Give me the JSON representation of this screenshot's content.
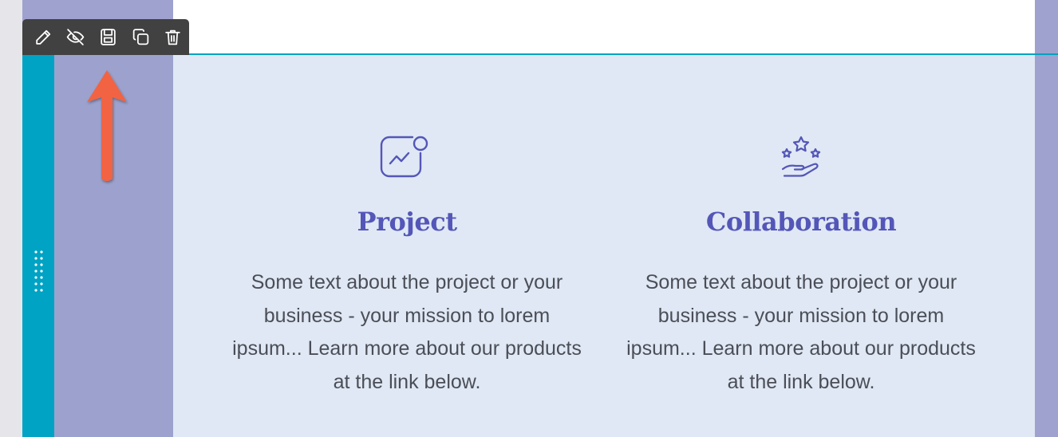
{
  "toolbar": {
    "buttons": [
      {
        "name": "edit",
        "icon": "pencil-icon"
      },
      {
        "name": "hide",
        "icon": "eye-off-icon"
      },
      {
        "name": "save",
        "icon": "floppy-disk-icon"
      },
      {
        "name": "duplicate",
        "icon": "copy-icon"
      },
      {
        "name": "delete",
        "icon": "trash-icon"
      }
    ]
  },
  "annotation": {
    "arrow_color": "#f16442",
    "points_to": "hide-button"
  },
  "cards": [
    {
      "icon": "image-chart-icon",
      "title": "Project",
      "text": "Some text about the project or your business - your mission to lorem ipsum... Learn more about our products at the link below."
    },
    {
      "icon": "hand-stars-icon",
      "title": "Collaboration",
      "text": "Some text about the project or your business - your mission to lorem ipsum... Learn more about our products at the link below."
    }
  ],
  "colors": {
    "selection": "#00a3c4",
    "toolbar_bg": "#414141",
    "section_bg": "#dfe8f4",
    "side_column": "#9ca2cd",
    "heading": "#5456b8",
    "body_text": "#4b4e57"
  }
}
